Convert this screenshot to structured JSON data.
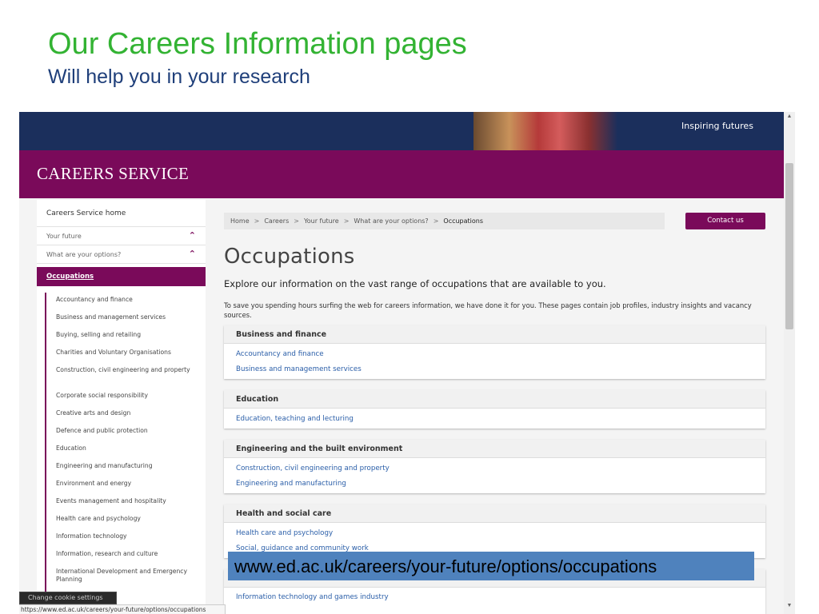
{
  "slide": {
    "title": "Our Careers Information pages",
    "subtitle": "Will help you in your research",
    "url_callout": "www.ed.ac.uk/careers/your-future/options/occupations"
  },
  "colors": {
    "title_green": "#33b333",
    "subtitle_navy": "#1f3f7a",
    "brand_purple": "#7a0a5a",
    "banner_navy": "#1b2f5c",
    "link_blue": "#2a5ea8",
    "callout_blue": "#4f82bd"
  },
  "site": {
    "tagline": "Inspiring futures",
    "brand_name": "CAREERS SERVICE"
  },
  "sidebar": {
    "home": "Careers Service home",
    "your_future": "Your future",
    "your_options": "What are your options?",
    "active": "Occupations",
    "chevron_icon": "chevron-up-icon",
    "items": [
      "Accountancy and finance",
      "Business and management services",
      "Buying, selling and retailing",
      "Charities and Voluntary Organisations",
      "Construction, civil engineering and property",
      "Corporate social responsibility",
      "Creative arts and design",
      "Defence and public protection",
      "Education",
      "Engineering and manufacturing",
      "Environment and energy",
      "Events management and hospitality",
      "Health care and psychology",
      "Information technology",
      "Information, research and culture",
      "International Development and Emergency Planning"
    ]
  },
  "breadcrumb": {
    "items": [
      "Home",
      "Careers",
      "Your future",
      "What are your options?",
      "Occupations"
    ],
    "separator": ">"
  },
  "contact_button": "Contact us",
  "main": {
    "heading": "Occupations",
    "lead": "Explore our information on the vast range of occupations that are available to you.",
    "intro": "To save you spending hours surfing the web for careers information, we have done it for you. These pages contain job profiles, industry insights and vacancy sources.",
    "cards": [
      {
        "title": "Business and finance",
        "links": [
          "Accountancy and finance",
          "Business and management services"
        ]
      },
      {
        "title": "Education",
        "links": [
          "Education, teaching and lecturing"
        ]
      },
      {
        "title": "Engineering and the built environment",
        "links": [
          "Construction, civil engineering and property",
          "Engineering and manufacturing"
        ]
      },
      {
        "title": "Health and social care",
        "links": [
          "Health care and psychology",
          "Social, guidance and community work"
        ]
      },
      {
        "title": "",
        "links": [
          "Information technology and games industry"
        ]
      }
    ]
  },
  "browser": {
    "settings_button": "Change cookie settings",
    "status_url": "https://www.ed.ac.uk/careers/your-future/options/occupations"
  }
}
